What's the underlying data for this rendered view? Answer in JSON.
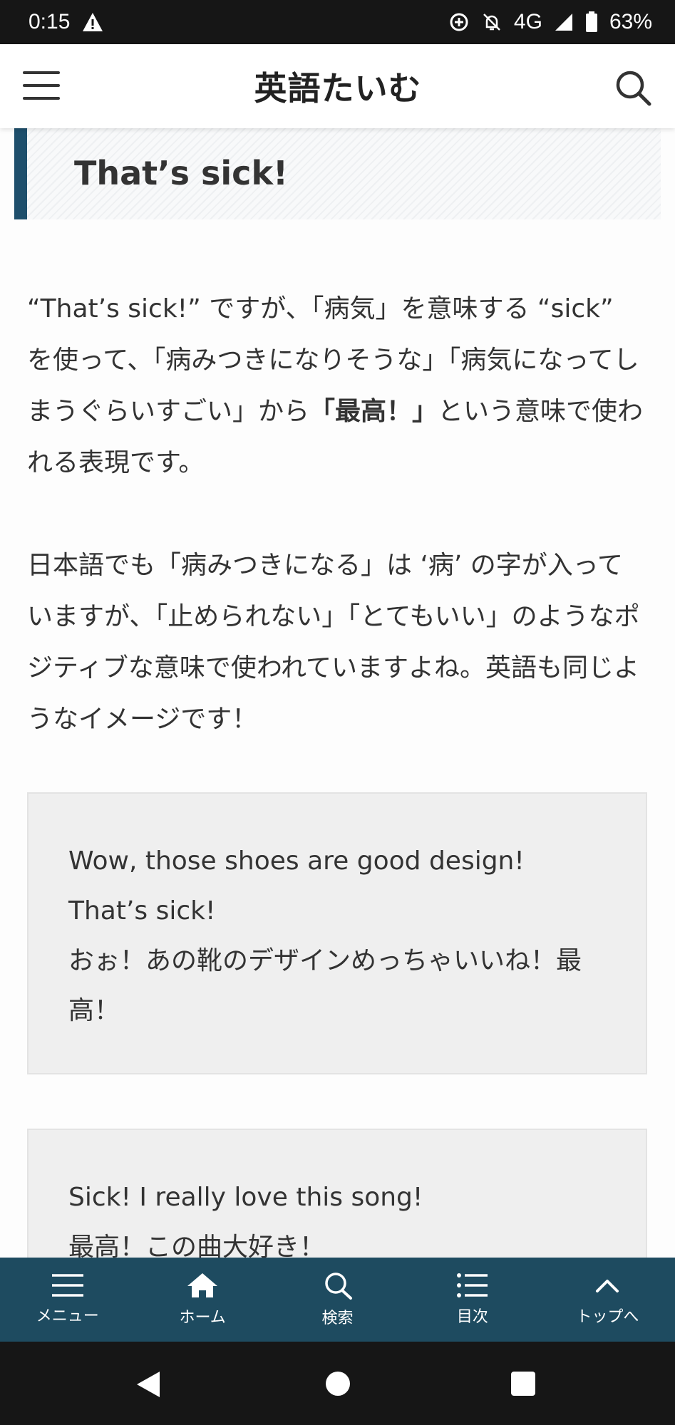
{
  "status_bar": {
    "time": "0:15",
    "network": "4G",
    "battery": "63%",
    "icons": [
      "warning-icon",
      "data-saver-icon",
      "bell-off-icon",
      "signal-icon",
      "battery-icon"
    ]
  },
  "header": {
    "site_title": "英語たいむ",
    "menu_icon": "hamburger-icon",
    "search_icon": "search-icon"
  },
  "content": {
    "heading": "That’s sick!",
    "para1_a": "“That’s sick!” ですが、「病気」を意味する “sick” を使って、「病みつきになりそうな」「病気になってしまうぐらいすごい」から",
    "para1_bold": "「最高！」",
    "para1_b": "という意味で使われる表現です。",
    "para2": "日本語でも「病みつきになる」は ‘病’ の字が入っていますが、「止められない」「とてもいい」のようなポジティブな意味で使われていますよね。英語も同じようなイメージです！",
    "example1": {
      "en": "Wow, those shoes are good design! That’s sick!",
      "ja": "おぉ！あの靴のデザインめっちゃいいね！最高！"
    },
    "example2": {
      "en": "Sick! I really love this song!",
      "ja": "最高！この曲大好き！"
    }
  },
  "bottom_nav": {
    "items": [
      {
        "label": "メニュー",
        "icon": "menu-icon"
      },
      {
        "label": "ホーム",
        "icon": "home-icon"
      },
      {
        "label": "検索",
        "icon": "search-icon"
      },
      {
        "label": "目次",
        "icon": "list-icon"
      },
      {
        "label": "トップへ",
        "icon": "chevron-up-icon"
      }
    ]
  },
  "colors": {
    "accent": "#1e4f6c",
    "nav_bg": "#1e4b60",
    "example_bg": "#efefef"
  }
}
